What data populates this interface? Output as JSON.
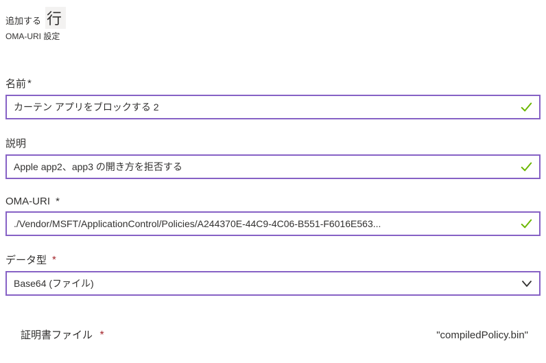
{
  "header": {
    "add_label": "追加する",
    "row_label": "行",
    "subheader": "OMA-URI 設定"
  },
  "fields": {
    "name": {
      "label": "名前",
      "required_marker": "*",
      "value": "カーテン アプリをブロックする 2"
    },
    "description": {
      "label": "説明",
      "value": "Apple app2、app3 の開き方を拒否する"
    },
    "oma_uri": {
      "label": "OMA-URI",
      "required_marker": "*",
      "value": "./Vendor/MSFT/ApplicationControl/Policies/A244370E-44C9-4C06-B551-F6016E563..."
    },
    "data_type": {
      "label": "データ型",
      "required_marker": "*",
      "value": "Base64 (ファイル)"
    },
    "cert_file": {
      "label": "証明書ファイル",
      "required_marker": "*",
      "filename": "\"compiledPolicy.bin\""
    }
  }
}
